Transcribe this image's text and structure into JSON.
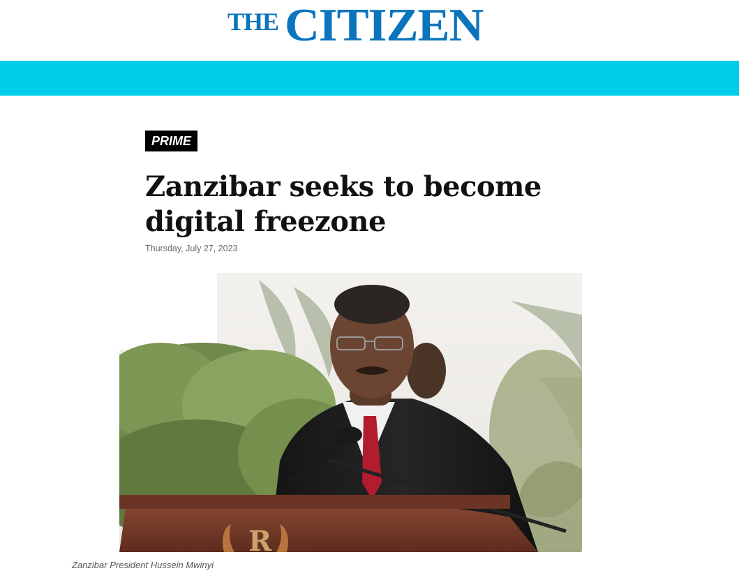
{
  "masthead": {
    "logo_small": "THE",
    "logo_main": "CITIZEN",
    "brand_color": "#0a74bd"
  },
  "navbar": {
    "color": "#00cde8"
  },
  "article": {
    "badge": "PRIME",
    "title": "Zanzibar seeks to become digital freezone",
    "date": "Thursday, July 27, 2023",
    "caption": "Zanzibar President Hussein Mwinyi"
  }
}
